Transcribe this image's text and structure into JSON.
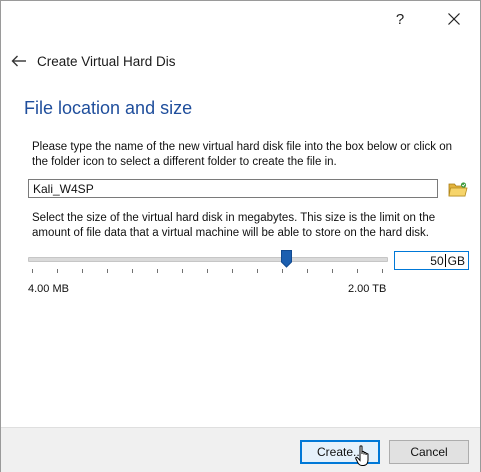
{
  "titlebar": {
    "help_label": "?",
    "icons": {
      "close": "close-icon"
    }
  },
  "header": {
    "back_icon": "arrow-left-icon",
    "title": "Create Virtual Hard Dis"
  },
  "section": {
    "title": "File location and size"
  },
  "file": {
    "description": "Please type the name of the new virtual hard disk file into the box below or click on the folder icon to select a different folder to create the file in.",
    "value": "Kali_W4SP",
    "folder_icon": "folder-icon"
  },
  "size": {
    "description": "Select the size of the virtual hard disk in megabytes. This size is the limit on the amount of file data that a virtual machine will be able to store on the hard disk.",
    "value": "50",
    "unit": "GB",
    "min_label": "4.00 MB",
    "max_label": "2.00 TB",
    "slider_fraction": 0.71
  },
  "buttons": {
    "create": "Create...",
    "cancel": "Cancel"
  },
  "colors": {
    "title_blue": "#1f4e9c",
    "accent_blue": "#0078d7",
    "thumb_blue": "#1c5fb0"
  }
}
